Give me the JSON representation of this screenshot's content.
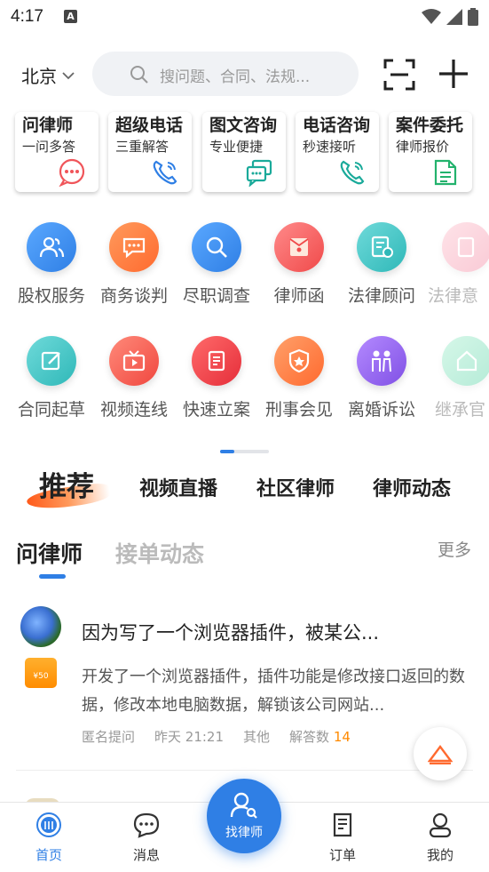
{
  "status_bar": {
    "time": "4:17",
    "notif_icon": "A"
  },
  "header": {
    "city": "北京",
    "search_placeholder": "搜问题、合同、法规..."
  },
  "service_cards": [
    {
      "title": "问律师",
      "subtitle": "一问多答",
      "icon": "chat-bubble-icon",
      "color": "#f0555a"
    },
    {
      "title": "超级电话",
      "subtitle": "三重解答",
      "icon": "phone-icon",
      "color": "#2f7fe5"
    },
    {
      "title": "图文咨询",
      "subtitle": "专业便捷",
      "icon": "messages-icon",
      "color": "#1aaa9a"
    },
    {
      "title": "电话咨询",
      "subtitle": "秒速接听",
      "icon": "phone-call-icon",
      "color": "#1aaa9a"
    },
    {
      "title": "案件委托",
      "subtitle": "律师报价",
      "icon": "document-icon",
      "color": "#23b26d"
    }
  ],
  "services_row1": [
    {
      "label": "股权服务",
      "icon": "people-icon",
      "color": "#3a8ef0"
    },
    {
      "label": "商务谈判",
      "icon": "chat-icon",
      "color": "#ff7a3d"
    },
    {
      "label": "尽职调查",
      "icon": "magnifier-icon",
      "color": "#2f7fe5"
    },
    {
      "label": "律师函",
      "icon": "envelope-icon",
      "color": "#ff6464"
    },
    {
      "label": "法律顾问",
      "icon": "advisor-icon",
      "color": "#35c2c2"
    },
    {
      "label": "法律意",
      "icon": "opinion-icon",
      "color": "#f38aa0"
    }
  ],
  "services_row2": [
    {
      "label": "合同起草",
      "icon": "pen-icon",
      "color": "#35c2c2"
    },
    {
      "label": "视频连线",
      "icon": "tv-icon",
      "color": "#ff5a4f"
    },
    {
      "label": "快速立案",
      "icon": "file-icon",
      "color": "#f04a4a"
    },
    {
      "label": "刑事会见",
      "icon": "shield-star-icon",
      "color": "#ff7a3d"
    },
    {
      "label": "离婚诉讼",
      "icon": "couple-icon",
      "color": "#9a6ef0"
    },
    {
      "label": "继承官",
      "icon": "house-icon",
      "color": "#3fd09a"
    }
  ],
  "tabs": [
    "推荐",
    "视频直播",
    "社区律师",
    "律师动态"
  ],
  "sub_tabs": {
    "active": "问律师",
    "inactive": "接单动态",
    "more": "更多"
  },
  "question": {
    "title": "因为写了一个浏览器插件，被某公...",
    "body": "开发了一个浏览器插件，插件功能是修改接口返回的数据，修改本地电脑数据，解锁该公司网站...",
    "reward": "¥50",
    "asker": "匿名提问",
    "time": "昨天 21:21",
    "category": "其他",
    "answers_label": "解答数",
    "answers_count": "14"
  },
  "bottom_nav": {
    "home": "首页",
    "messages": "消息",
    "find_lawyer": "找律师",
    "orders": "订单",
    "mine": "我的",
    "active_color": "#2f7fe5"
  }
}
